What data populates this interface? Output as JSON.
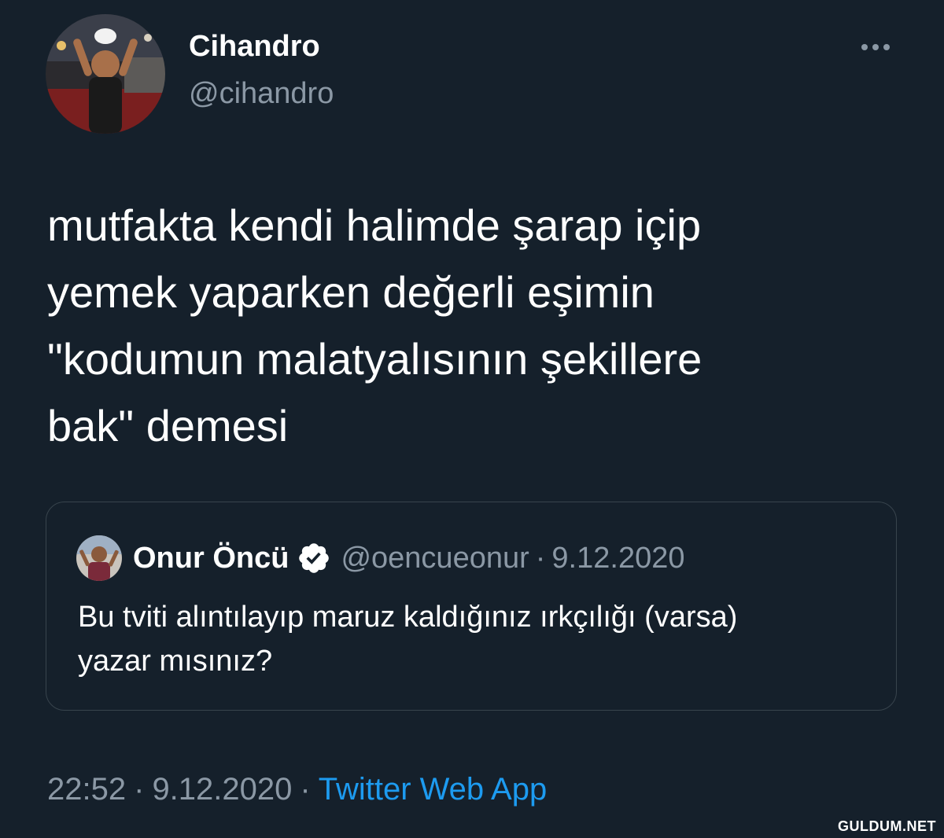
{
  "author": {
    "name": "Cihandro",
    "handle": "@cihandro",
    "avatar_icon": "profile-photo"
  },
  "more_icon": "more-dots-icon",
  "tweet": {
    "lines": [
      "mutfakta kendi halimde şarap içip",
      "yemek yaparken değerli eşimin",
      "\"kodumun malatyalısının şekillere",
      "bak\" demesi"
    ]
  },
  "quoted_tweet": {
    "name": "Onur Öncü",
    "verified_icon": "verified-badge-icon",
    "handle": "@oencueonur",
    "separator": "·",
    "date": "9.12.2020",
    "lines": [
      "Bu tviti alıntılayıp maruz kaldığınız ırkçılığı (varsa)",
      "yazar mısınız?"
    ]
  },
  "meta": {
    "time": "22:52",
    "separator": "·",
    "date": "9.12.2020",
    "source": "Twitter Web App"
  },
  "watermark": "GULDUM.NET",
  "colors": {
    "background": "#15202b",
    "secondary_text": "#8b98a5",
    "link": "#1d9bf0",
    "border": "#38444d"
  }
}
